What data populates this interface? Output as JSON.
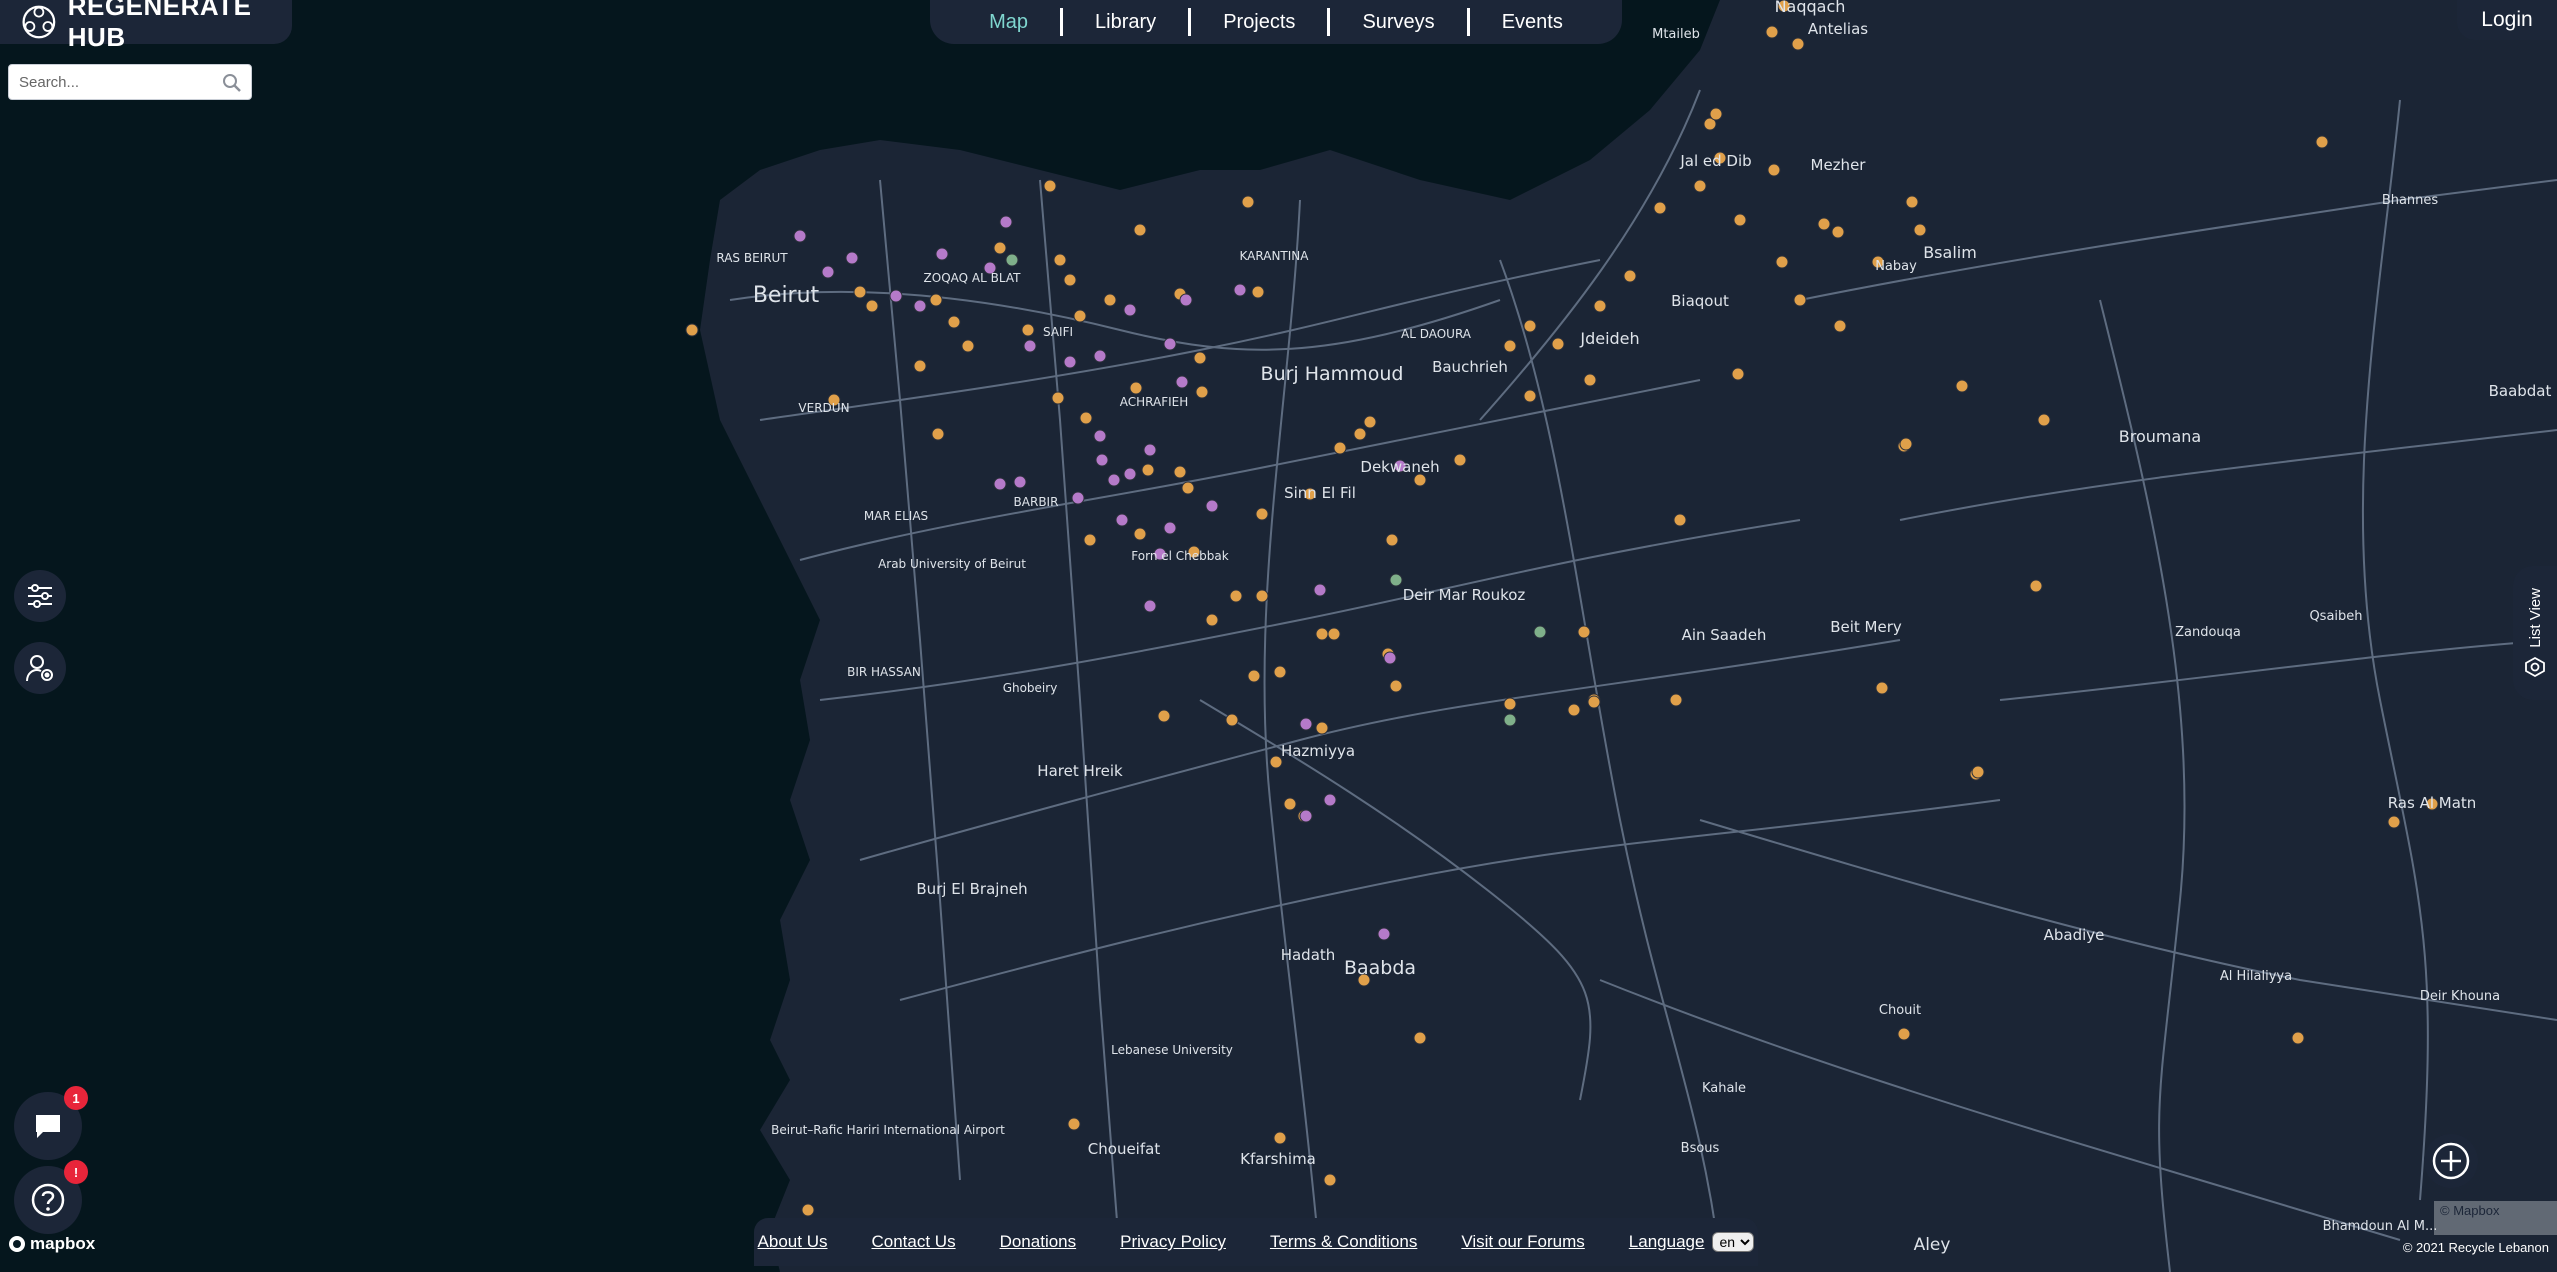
{
  "brand": {
    "title": "REGENERATE HUB"
  },
  "search": {
    "placeholder": "Search..."
  },
  "nav": [
    {
      "label": "Map",
      "active": true
    },
    {
      "label": "Library",
      "active": false
    },
    {
      "label": "Projects",
      "active": false
    },
    {
      "label": "Surveys",
      "active": false
    },
    {
      "label": "Events",
      "active": false
    }
  ],
  "login_label": "Login",
  "list_view_label": "List View",
  "chat_badge": "1",
  "help_badge": "!",
  "footer": {
    "links": [
      "About Us",
      "Contact Us",
      "Donations",
      "Privacy Policy",
      "Terms & Conditions",
      "Visit our Forums"
    ],
    "language_label": "Language",
    "language_value": "en"
  },
  "attribution": {
    "mapbox_logo": "mapbox",
    "mapbox_credit": "© Mapbox",
    "copyright": "© 2021 Recycle Lebanon"
  },
  "map_labels": [
    {
      "text": "Naqqach",
      "size": 16
    },
    {
      "text": "Mtaileb",
      "size": 13
    },
    {
      "text": "Antelias",
      "size": 15
    },
    {
      "text": "Jal ed Dib",
      "size": 15
    },
    {
      "text": "Mezher",
      "size": 15
    },
    {
      "text": "Bsalim",
      "size": 16
    },
    {
      "text": "Nabay",
      "size": 13
    },
    {
      "text": "Bhannes",
      "size": 13
    },
    {
      "text": "Biaqout",
      "size": 15
    },
    {
      "text": "Jdeideh",
      "size": 16
    },
    {
      "text": "Baabdat",
      "size": 15
    },
    {
      "text": "Broumana",
      "size": 16
    },
    {
      "text": "Beirut",
      "size": 22
    },
    {
      "text": "RAS BEIRUT",
      "size": 12
    },
    {
      "text": "ZOQAQ AL BLAT",
      "size": 12
    },
    {
      "text": "SAIFI",
      "size": 12
    },
    {
      "text": "KARANTINA",
      "size": 12
    },
    {
      "text": "AL DAOURA",
      "size": 12
    },
    {
      "text": "Burj Hammoud",
      "size": 19
    },
    {
      "text": "Bauchrieh",
      "size": 15
    },
    {
      "text": "VERDUN",
      "size": 12
    },
    {
      "text": "ACHRAFIEH",
      "size": 12
    },
    {
      "text": "Dekwaneh",
      "size": 15
    },
    {
      "text": "Sinn El Fil",
      "size": 15
    },
    {
      "text": "BARBIR",
      "size": 12
    },
    {
      "text": "MAR ELIAS",
      "size": 12
    },
    {
      "text": "Arab University of Beirut",
      "size": 12
    },
    {
      "text": "Forn el Chebbak",
      "size": 12
    },
    {
      "text": "Deir Mar Roukoz",
      "size": 15
    },
    {
      "text": "Ain Saadeh",
      "size": 15
    },
    {
      "text": "Beit Mery",
      "size": 15
    },
    {
      "text": "Zandouqa",
      "size": 13
    },
    {
      "text": "Qsaibeh",
      "size": 13
    },
    {
      "text": "BIR HASSAN",
      "size": 12
    },
    {
      "text": "Ghobeiry",
      "size": 12
    },
    {
      "text": "Hazmiyya",
      "size": 15
    },
    {
      "text": "Haret Hreik",
      "size": 15
    },
    {
      "text": "Ras Al Matn",
      "size": 15
    },
    {
      "text": "Burj El Brajneh",
      "size": 15
    },
    {
      "text": "Abadiye",
      "size": 15
    },
    {
      "text": "Hadath",
      "size": 15
    },
    {
      "text": "Baabda",
      "size": 19
    },
    {
      "text": "Al Hilaliyya",
      "size": 13
    },
    {
      "text": "Chouit",
      "size": 13
    },
    {
      "text": "Deir Khouna",
      "size": 13
    },
    {
      "text": "Lebanese University",
      "size": 12
    },
    {
      "text": "Kahale",
      "size": 13
    },
    {
      "text": "Beirut–Rafic Hariri International Airport",
      "size": 12
    },
    {
      "text": "Choueifat",
      "size": 15
    },
    {
      "text": "Kfarshima",
      "size": 15
    },
    {
      "text": "Bsous",
      "size": 13
    },
    {
      "text": "Bhamdoun Al M...",
      "size": 13
    },
    {
      "text": "Aley",
      "size": 17
    }
  ],
  "colors": {
    "panel": "#1c2638",
    "sea": "#05161d",
    "land": "#1b2535",
    "nav_active": "#7fd6cf",
    "marker_orange": "#e0a04a",
    "marker_purple": "#b57ac9",
    "marker_green": "#7fb08a",
    "badge": "#e8253a"
  },
  "icons": {
    "brand": "logo-icon",
    "search": "search-icon",
    "filters": "sliders-icon",
    "user_location": "user-pin-icon",
    "chat": "chat-icon",
    "help": "question-icon",
    "list_view": "layers-icon",
    "zoom_in": "plus-icon"
  }
}
